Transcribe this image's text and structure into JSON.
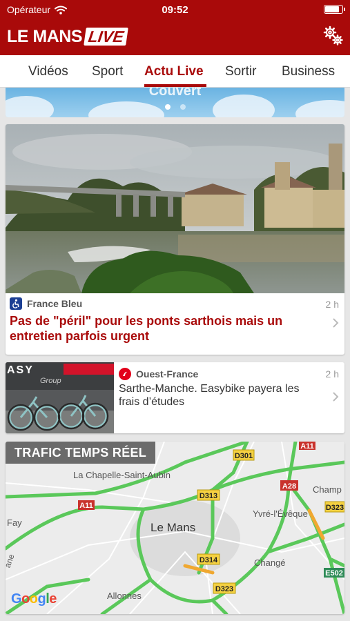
{
  "status": {
    "carrier": "Opérateur",
    "time": "09:52",
    "battery_level": 0.9
  },
  "header": {
    "logo_part1": "LE MANS",
    "logo_part2": "LIVE",
    "accent": "#a90a0a"
  },
  "tabs": [
    {
      "label": "Vidéos",
      "active": false
    },
    {
      "label": "Sport",
      "active": false
    },
    {
      "label": "Actu Live",
      "active": true
    },
    {
      "label": "Sortir",
      "active": false
    },
    {
      "label": "Business",
      "active": false
    }
  ],
  "weather": {
    "label": "Couvert",
    "pages": 2,
    "current_page": 1
  },
  "articles": [
    {
      "source": "France Bleu",
      "source_icon": "accessibility-icon",
      "source_color": "#1c3f94",
      "age": "2 h",
      "title": "Pas de \"péril\" pour les ponts sarthois mais un entretien parfois urgent",
      "title_color": "#a90a0a"
    },
    {
      "source": "Ouest-France",
      "source_icon": "ouest-france-icon",
      "source_color": "#e2001a",
      "age": "2 h",
      "title": "Sarthe-Manche. Easybike payera les frais d’études",
      "title_color": "#333333",
      "thumbnail_text": "ASY",
      "thumbnail_subtext": "Group"
    }
  ],
  "traffic": {
    "title": "TRAFIC TEMPS RÉEL",
    "places": [
      "La Chapelle-Saint-Aubin",
      "Le Mans",
      "Yvré-l'Évêque",
      "Changé",
      "Allonnes",
      "Fay",
      "Champ",
      "ane"
    ],
    "roads": [
      "D301",
      "A11",
      "A11",
      "D313",
      "A28",
      "D323",
      "D314",
      "D323",
      "E502"
    ],
    "attribution": "Google"
  }
}
